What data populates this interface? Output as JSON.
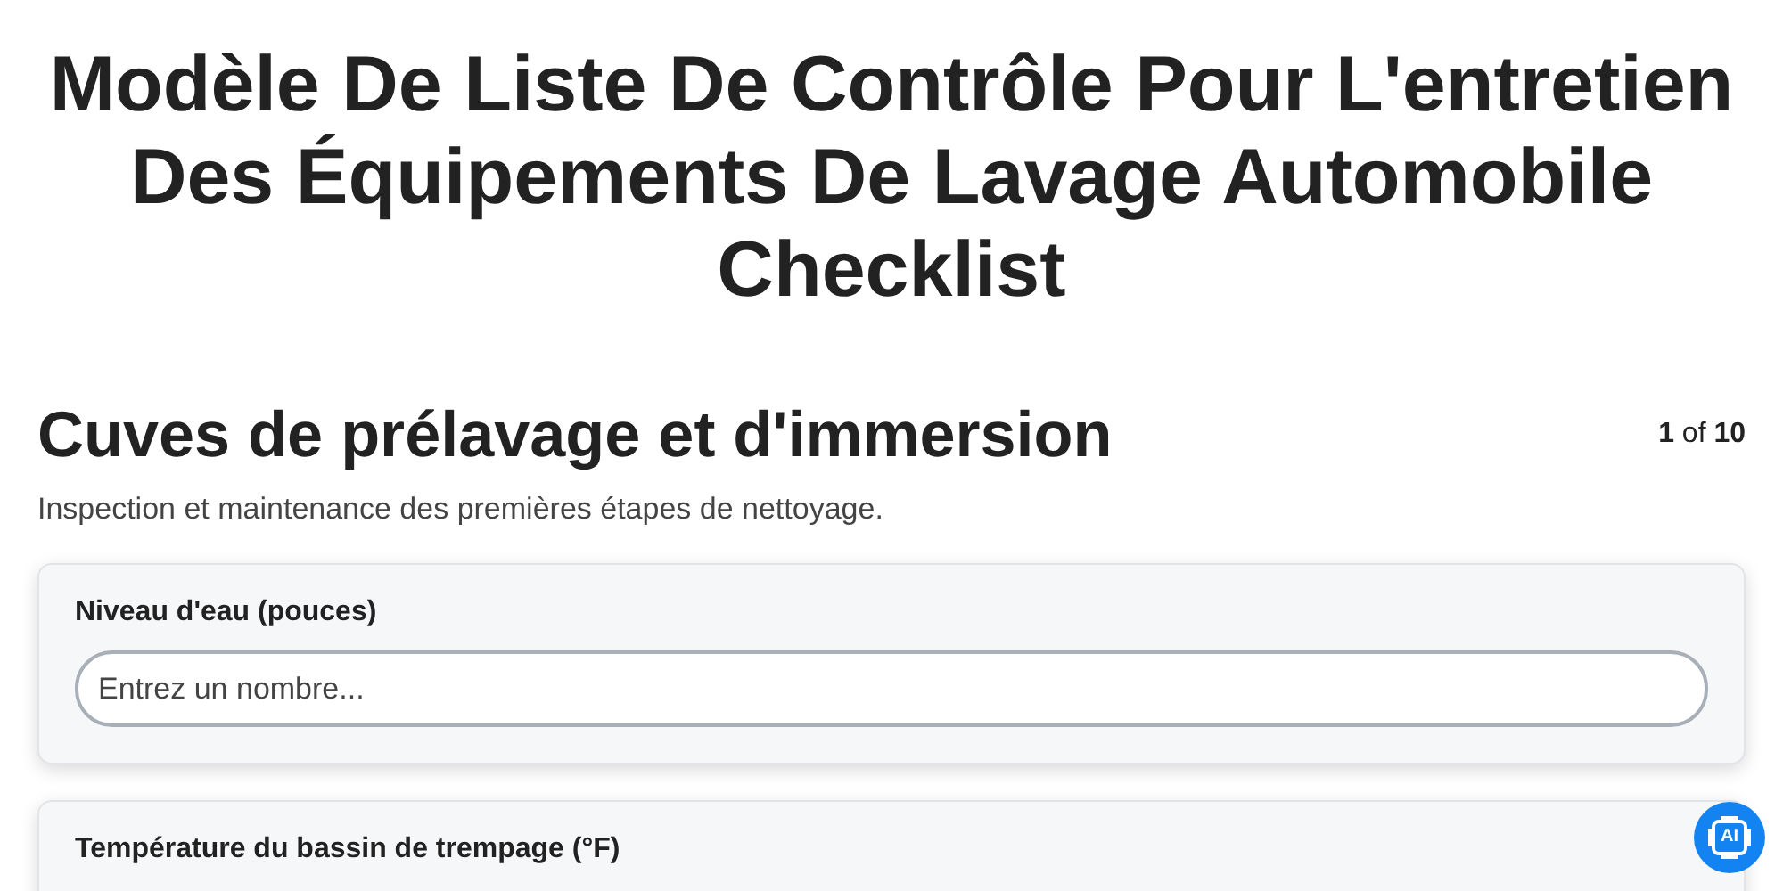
{
  "title": "Modèle De Liste De Contrôle Pour L'entretien Des Équipements De Lavage Automobile Checklist",
  "section": {
    "heading": "Cuves de prélavage et d'immersion",
    "pager": "**1** of **10**",
    "description": "Inspection et maintenance des premières étapes de nettoyage."
  },
  "fields": [
    {
      "label": "Niveau d'eau (pouces)",
      "placeholder": "Entrez un nombre..."
    },
    {
      "label": "Température du bassin de trempage (°F)"
    }
  ],
  "assistant_button": {
    "label": "AI"
  }
}
